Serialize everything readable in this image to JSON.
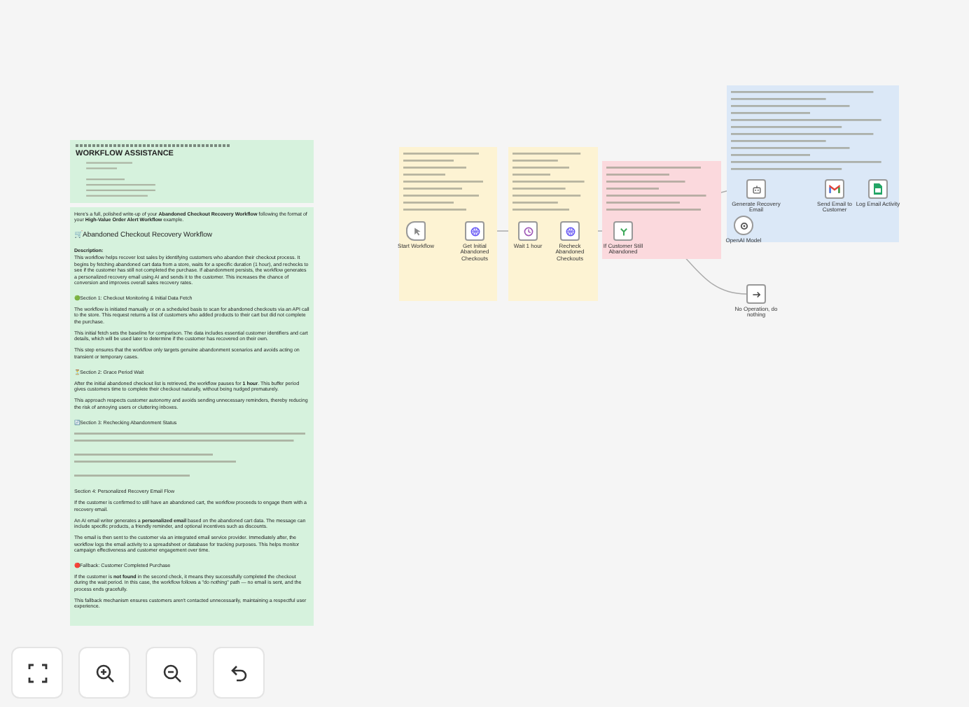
{
  "assistant_note": {
    "title": "WORKFLOW ASSISTANCE",
    "blocks": [
      {
        "kind": "paragraph",
        "text": "Here's a full, polished write-up of your **Abandoned Checkout Recovery Workflow** following the format of your **High-Value Order Alert Workflow** example."
      },
      {
        "kind": "title",
        "text": "🛒Abandoned Checkout Recovery Workflow"
      },
      {
        "kind": "label",
        "text": "Description:"
      },
      {
        "kind": "paragraph",
        "text": "This workflow helps recover lost sales by identifying customers who abandon their checkout process. It begins by fetching abandoned cart data from a store, waits for a specific duration (1 hour), and rechecks to see if the customer has still not completed the purchase. If abandonment persists, the workflow generates a personalized recovery email using AI and sends it to the customer. This increases the chance of conversion and improves overall sales recovery rates."
      },
      {
        "kind": "heading",
        "text": "🟢Section 1: Checkout Monitoring & Initial Data Fetch"
      },
      {
        "kind": "paragraph",
        "text": "The workflow is initiated manually or on a scheduled basis to scan for abandoned checkouts via an API call to the store. This request returns a list of customers who added products to their cart but did not complete the purchase."
      },
      {
        "kind": "paragraph",
        "text": "This initial fetch sets the baseline for comparison. The data includes essential customer identifiers and cart details, which will be used later to determine if the customer has recovered on their own."
      },
      {
        "kind": "paragraph",
        "text": "This step ensures that the workflow only targets genuine abandonment scenarios and avoids acting on transient or temporary cases."
      },
      {
        "kind": "heading",
        "text": "⏳Section 2: Grace Period Wait"
      },
      {
        "kind": "paragraph",
        "text": "After the initial abandoned checkout list is retrieved, the workflow pauses for **1 hour**. This buffer period gives customers time to complete their checkout naturally, without being nudged prematurely."
      },
      {
        "kind": "paragraph",
        "text": "This approach respects customer autonomy and avoids sending unnecessary reminders, thereby reducing the risk of annoying users or cluttering inboxes."
      },
      {
        "kind": "heading",
        "text": "🔄Section 3: Rechecking Abandonment Status"
      },
      {
        "kind": "greeked"
      },
      {
        "kind": "heading",
        "text": "Section 4: Personalized Recovery Email Flow"
      },
      {
        "kind": "paragraph",
        "text": "If the customer is confirmed to still have an abandoned cart, the workflow proceeds to engage them with a recovery email."
      },
      {
        "kind": "paragraph",
        "text": "An AI email writer generates a **personalized email** based on the abandoned cart data. The message can include specific products, a friendly reminder, and optional incentives such as discounts."
      },
      {
        "kind": "paragraph",
        "text": "The email is then sent to the customer via an integrated email service provider. Immediately after, the workflow logs the email activity to a spreadsheet or database for tracking purposes. This helps monitor campaign effectiveness and customer engagement over time."
      },
      {
        "kind": "heading",
        "text": "🔴Fallback: Customer Completed Purchase"
      },
      {
        "kind": "paragraph",
        "text": "If the customer is **not found** in the second check, it means they successfully completed the checkout during the wait period. In this case, the workflow follows a \"do nothing\" path — no email is sent, and the process ends gracefully."
      },
      {
        "kind": "paragraph",
        "text": "This fallback mechanism ensures customers aren't contacted unnecessarily, maintaining a respectful user experience."
      }
    ]
  },
  "sticky_notes": [
    {
      "color": "#fdf3d3"
    },
    {
      "color": "#fdf3d3"
    },
    {
      "color": "#fbd9dd"
    },
    {
      "color": "#dbe8f7"
    }
  ],
  "nodes": [
    {
      "kind": "trigger",
      "label": "Start Workflow"
    },
    {
      "kind": "http",
      "label": "Get Initial Abandoned Checkouts"
    },
    {
      "kind": "wait",
      "label": "Wait 1 hour"
    },
    {
      "kind": "http",
      "label": "Recheck Abandoned Checkouts"
    },
    {
      "kind": "if",
      "label": "If Customer Still Abandoned"
    },
    {
      "kind": "ai",
      "label": "Generate Recovery Email"
    },
    {
      "kind": "gmail",
      "label": "Send Email to Customer"
    },
    {
      "kind": "sheets",
      "label": "Log Email Activity"
    },
    {
      "kind": "model",
      "label": "OpenAI Model"
    },
    {
      "kind": "noop",
      "label": "No Operation, do nothing"
    }
  ]
}
